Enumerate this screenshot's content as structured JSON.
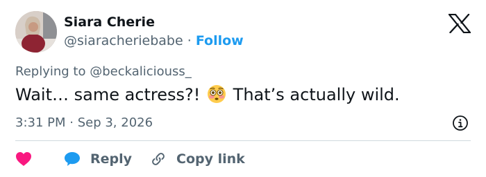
{
  "author": {
    "display_name": "Siara Cherie",
    "handle": "@siaracheriebabe",
    "separator": "·",
    "follow_label": "Follow"
  },
  "reply_context": {
    "text": "Replying to @beckaliciouss_"
  },
  "tweet": {
    "text_before_emoji": "Wait… same actress?!",
    "emoji": "flushed-face-emoji",
    "text_after_emoji": "That’s actually wild."
  },
  "meta": {
    "timestamp": "3:31 PM · Sep 3, 2026"
  },
  "actions": {
    "like_icon": "heart-icon",
    "reply_label": "Reply",
    "copy_link_label": "Copy link"
  },
  "colors": {
    "accent": "#1d9bf0",
    "like": "#f91880",
    "text_primary": "#0f1419",
    "text_secondary": "#536471",
    "divider": "#cfd9de"
  }
}
